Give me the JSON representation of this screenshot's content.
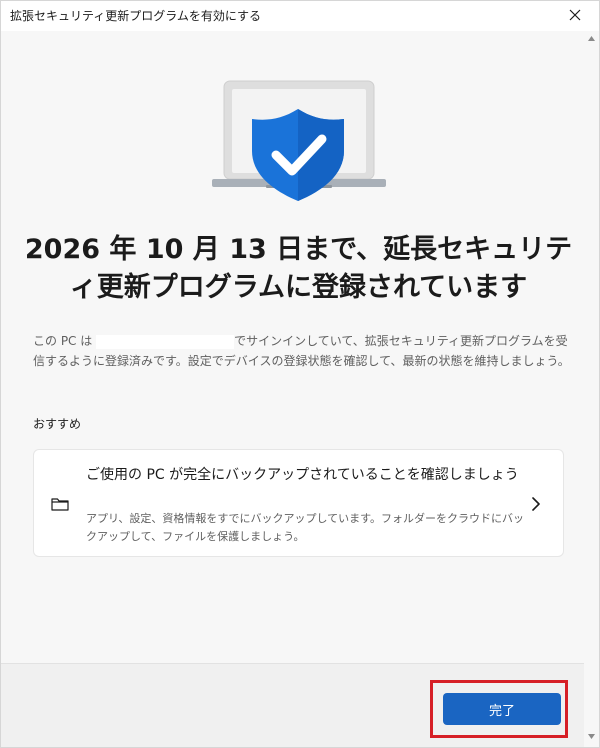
{
  "window": {
    "title": "拡張セキュリティ更新プログラムを有効にする"
  },
  "content": {
    "headline": "2026 年 10 月 13 日まで、延長セキュリティ更新プログラムに登録されています",
    "description_prefix": "この PC は",
    "description_suffix": "でサインインしていて、拡張セキュリティ更新プログラムを受信するように登録済みです。設定でデバイスの登録状態を確認して、最新の状態を維持しましょう。",
    "recommendations_label": "おすすめ"
  },
  "recommendation": {
    "title": "ご使用の PC が完全にバックアップされていることを確認しましょう",
    "description": "アプリ、設定、資格情報をすでにバックアップしています。フォルダーをクラウドにバックアップして、ファイルを保護しましょう。",
    "icon": "folder-icon"
  },
  "footer": {
    "done_label": "完了"
  },
  "colors": {
    "accent": "#1a65c2",
    "shield": "#1a73d9",
    "highlight": "#d61f26"
  }
}
